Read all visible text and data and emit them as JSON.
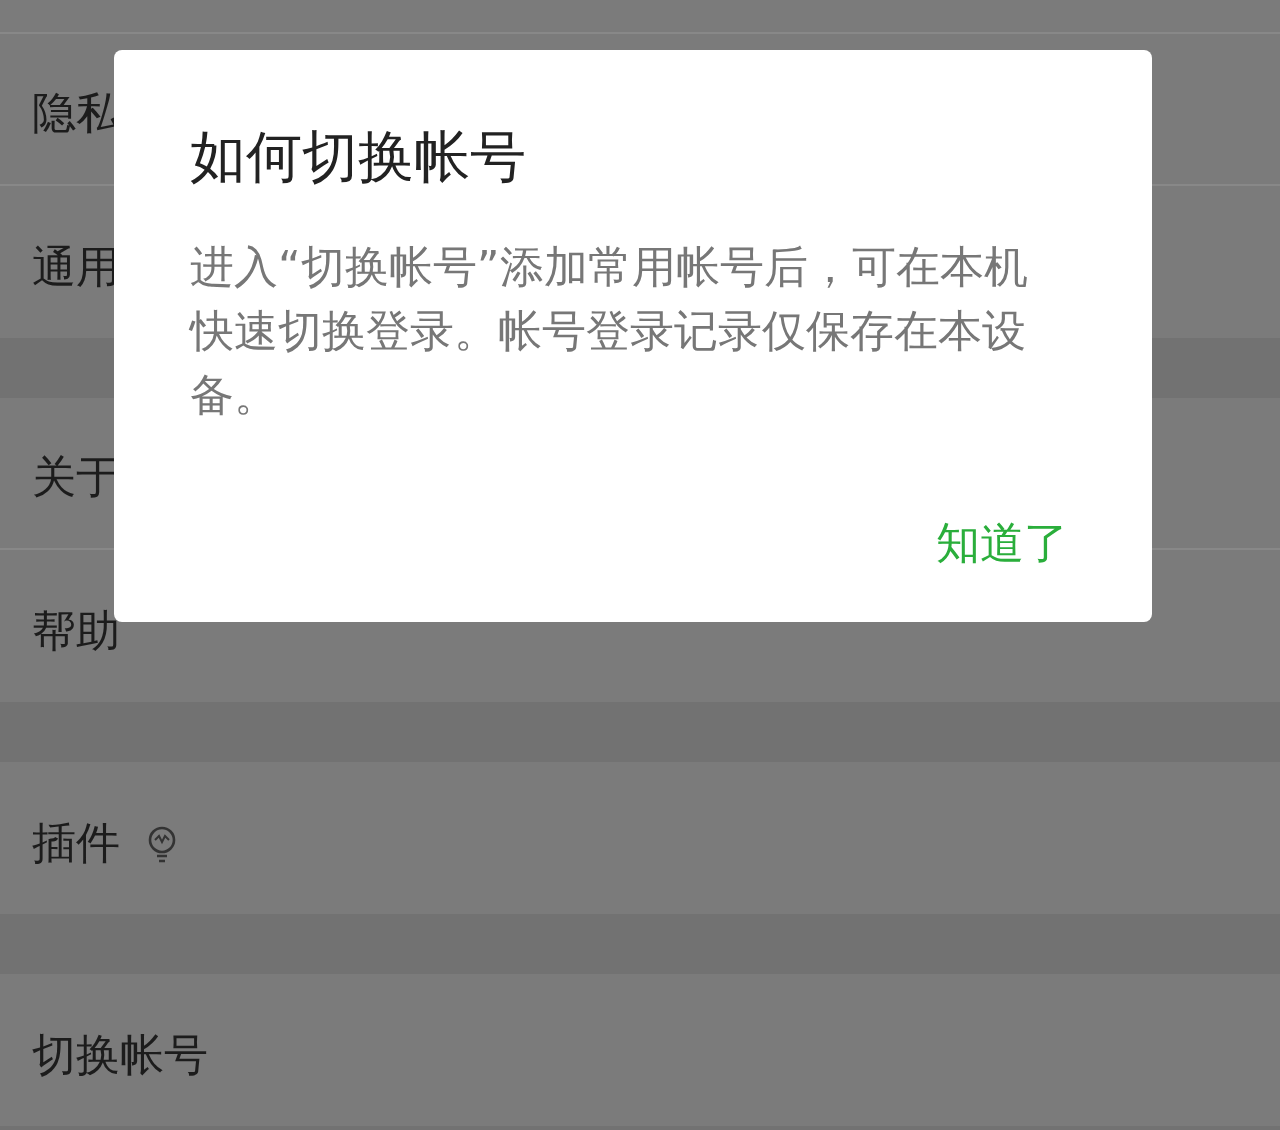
{
  "settings_sections": [
    {
      "items": [
        {
          "label": "隐私"
        },
        {
          "label": "通用"
        }
      ]
    },
    {
      "items": [
        {
          "label": "关于"
        },
        {
          "label": "帮助"
        }
      ]
    },
    {
      "items": [
        {
          "label": "插件",
          "kind": "with_icon"
        }
      ]
    },
    {
      "items": [
        {
          "label": "切换帐号"
        }
      ]
    }
  ],
  "dialog": {
    "title": "如何切换帐号",
    "message": "进入“切换帐号”添加常用帐号后，可在本机快速切换登录。帐号登录记录仅保存在本设备。",
    "button": "知道了"
  }
}
